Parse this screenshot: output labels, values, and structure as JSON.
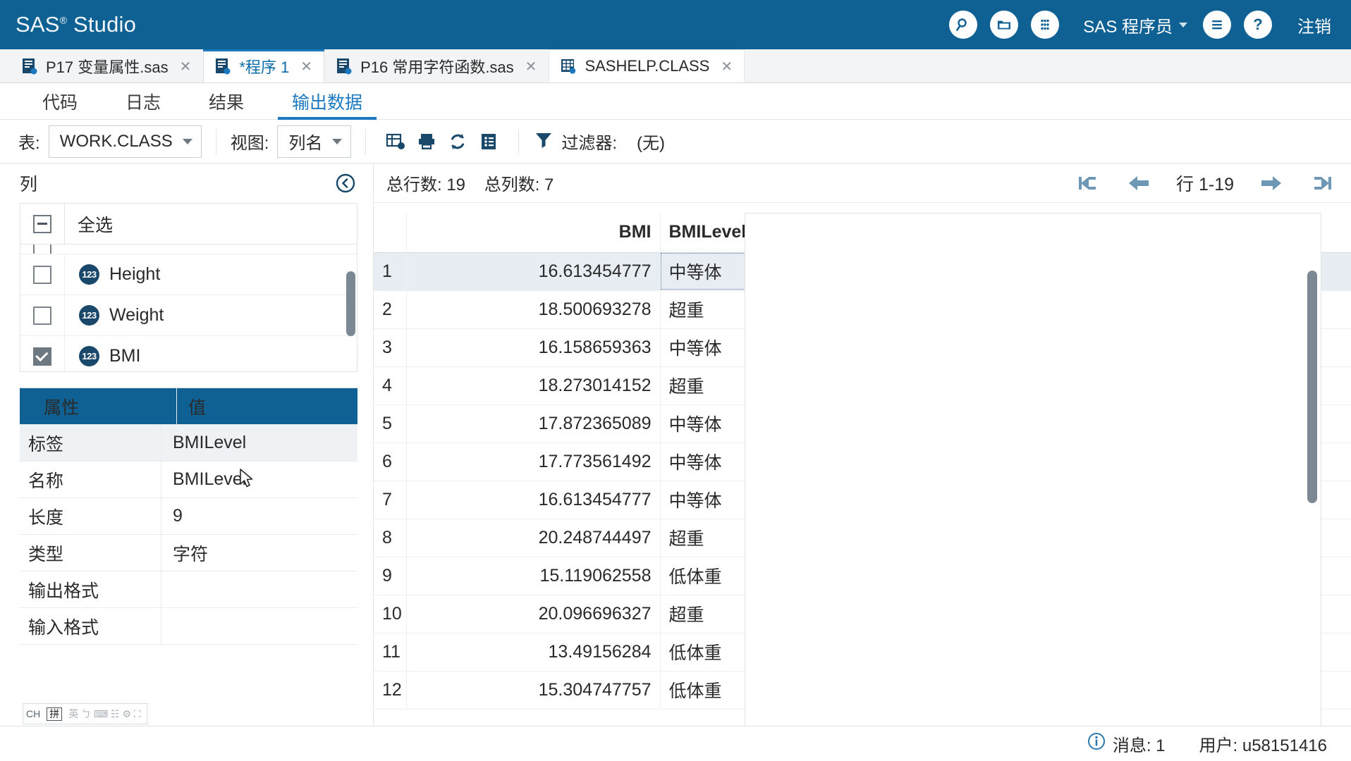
{
  "header": {
    "brand": "SAS",
    "brand_sup": "®",
    "brand_suffix": "Studio",
    "user_label": "SAS 程序员",
    "logout_label": "注销",
    "icons": [
      "search-icon",
      "folder-icon",
      "apps-grid-icon",
      "options-menu-icon",
      "help-icon"
    ],
    "brand_color": "#0f6194"
  },
  "tabs": [
    {
      "label": "P17 变量属性.sas",
      "icon": "sas-program-icon",
      "active": false,
      "close": "✕"
    },
    {
      "label": "*程序 1",
      "icon": "sas-program-icon",
      "active": true,
      "close": "✕"
    },
    {
      "label": "P16 常用字符函数.sas",
      "icon": "sas-program-icon",
      "active": false,
      "close": "✕"
    },
    {
      "label": "SASHELP.CLASS",
      "icon": "sas-table-icon",
      "active": false,
      "close": "✕"
    }
  ],
  "subtabs": [
    {
      "label": "代码",
      "active": false
    },
    {
      "label": "日志",
      "active": false
    },
    {
      "label": "结果",
      "active": false
    },
    {
      "label": "输出数据",
      "active": true
    }
  ],
  "toolbar": {
    "table_label": "表:",
    "table_value": "WORK.CLASS",
    "view_label": "视图:",
    "view_value": "列名",
    "buttons": [
      {
        "name": "open-table-icon"
      },
      {
        "name": "save-table-icon"
      },
      {
        "name": "refresh-icon"
      },
      {
        "name": "properties-icon"
      }
    ],
    "filter_icon": "filter-funnel-icon",
    "filter_label": "过滤器:",
    "filter_value": "(无)"
  },
  "left_panel": {
    "title": "列",
    "collapse_icon": "collapse-left-icon",
    "select_all_label": "全选",
    "columns": [
      {
        "name": "Height",
        "type_icon": "numeric-123-icon",
        "checked": false
      },
      {
        "name": "Weight",
        "type_icon": "numeric-123-icon",
        "checked": false
      },
      {
        "name": "BMI",
        "type_icon": "numeric-123-icon",
        "checked": true
      }
    ],
    "properties_header": {
      "key": "属性",
      "value": "值"
    },
    "properties": [
      {
        "key": "标签",
        "value": "BMILevel",
        "selected": true
      },
      {
        "key": "名称",
        "value": "BMILevel",
        "selected": false
      },
      {
        "key": "长度",
        "value": "9",
        "selected": false
      },
      {
        "key": "类型",
        "value": "字符",
        "selected": false
      },
      {
        "key": "输出格式",
        "value": "",
        "selected": false
      },
      {
        "key": "输入格式",
        "value": "",
        "selected": false
      }
    ],
    "ime": {
      "mode": "CH",
      "key": "拼",
      "glyphs": "英 ㄅ ⌨ ☷ ⚙ ⛶"
    }
  },
  "grid": {
    "total_rows_label": "总行数: 19",
    "total_cols_label": "总列数: 7",
    "pager": {
      "first_icon": "first-page-icon",
      "prev_icon": "prev-page-icon",
      "range_label": "行 1-19",
      "next_icon": "next-page-icon",
      "last_icon": "last-page-icon"
    },
    "columns": [
      "",
      "BMI",
      "BMILevel",
      ""
    ],
    "rows": [
      {
        "idx": "1",
        "bmi": "16.613454777",
        "level": "中等体",
        "selected": true
      },
      {
        "idx": "2",
        "bmi": "18.500693278",
        "level": "超重",
        "selected": false
      },
      {
        "idx": "3",
        "bmi": "16.158659363",
        "level": "中等体",
        "selected": false
      },
      {
        "idx": "4",
        "bmi": "18.273014152",
        "level": "超重",
        "selected": false
      },
      {
        "idx": "5",
        "bmi": "17.872365089",
        "level": "中等体",
        "selected": false
      },
      {
        "idx": "6",
        "bmi": "17.773561492",
        "level": "中等体",
        "selected": false
      },
      {
        "idx": "7",
        "bmi": "16.613454777",
        "level": "中等体",
        "selected": false
      },
      {
        "idx": "8",
        "bmi": "20.248744497",
        "level": "超重",
        "selected": false
      },
      {
        "idx": "9",
        "bmi": "15.119062558",
        "level": "低体重",
        "selected": false
      },
      {
        "idx": "10",
        "bmi": "20.096696327",
        "level": "超重",
        "selected": false
      },
      {
        "idx": "11",
        "bmi": "13.49156284",
        "level": "低体重",
        "selected": false
      },
      {
        "idx": "12",
        "bmi": "15.304747757",
        "level": "低体重",
        "selected": false
      }
    ]
  },
  "statusbar": {
    "message_icon": "info-icon",
    "message_label": "消息: 1",
    "user_label": "用户: u58151416"
  }
}
